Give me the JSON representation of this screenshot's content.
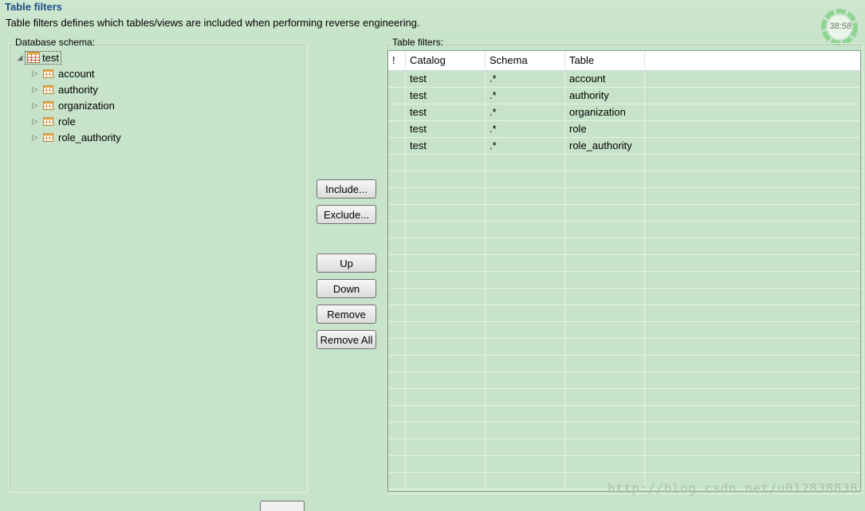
{
  "header": {
    "title": "Table filters",
    "description": "Table filters defines which tables/views are included when performing reverse engineering."
  },
  "timer": {
    "text": "38:58"
  },
  "schema_panel": {
    "label": "Database schema:",
    "root": {
      "label": "test",
      "icon": "database-icon"
    },
    "tables": [
      {
        "label": "account",
        "icon": "table-icon"
      },
      {
        "label": "authority",
        "icon": "table-icon"
      },
      {
        "label": "organization",
        "icon": "table-icon"
      },
      {
        "label": "role",
        "icon": "table-icon"
      },
      {
        "label": "role_authority",
        "icon": "table-icon"
      }
    ]
  },
  "buttons": {
    "include": "Include...",
    "exclude": "Exclude...",
    "up": "Up",
    "down": "Down",
    "remove": "Remove",
    "remove_all": "Remove All"
  },
  "filters_panel": {
    "label": "Table filters:",
    "columns": [
      "!",
      "Catalog",
      "Schema",
      "Table",
      ""
    ],
    "rows": [
      [
        "",
        "test",
        ".*",
        "account",
        ""
      ],
      [
        "",
        "test",
        ".*",
        "authority",
        ""
      ],
      [
        "",
        "test",
        ".*",
        "organization",
        ""
      ],
      [
        "",
        "test",
        ".*",
        "role",
        ""
      ],
      [
        "",
        "test",
        ".*",
        "role_authority",
        ""
      ]
    ]
  },
  "watermark": "http://blog.csdn.net/u012838838",
  "colors": {
    "background": "#c7e3c9",
    "title": "#1c4f8a"
  }
}
